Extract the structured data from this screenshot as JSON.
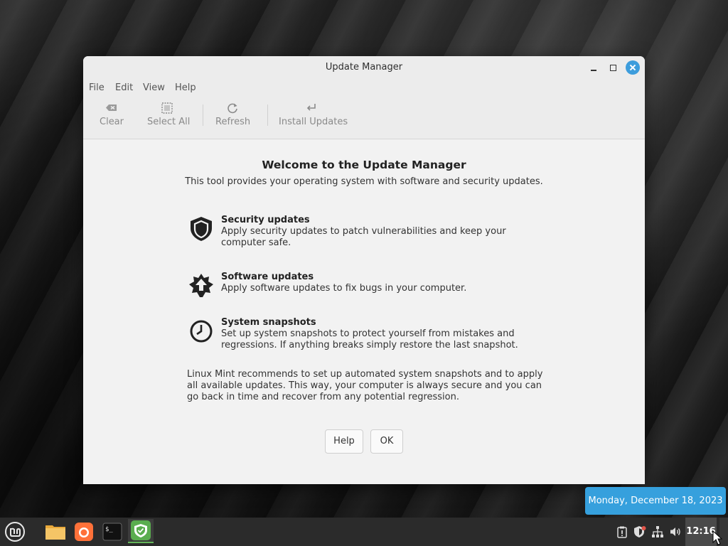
{
  "window": {
    "title": "Update Manager",
    "menu": [
      "File",
      "Edit",
      "View",
      "Help"
    ],
    "toolbar": {
      "clear": "Clear",
      "select_all": "Select All",
      "refresh": "Refresh",
      "install_updates": "Install Updates"
    }
  },
  "welcome": {
    "title": "Welcome to the Update Manager",
    "subtitle": "This tool provides your operating system with software and security updates.",
    "features": [
      {
        "icon": "shield-icon",
        "title": "Security updates",
        "description": "Apply security updates to patch vulnerabilities and keep your computer safe."
      },
      {
        "icon": "star-arrow-icon",
        "title": "Software updates",
        "description": "Apply software updates to fix bugs in your computer."
      },
      {
        "icon": "clock-icon",
        "title": "System snapshots",
        "description": "Set up system snapshots to protect yourself from mistakes and regressions. If anything breaks simply restore the last snapshot."
      }
    ],
    "recommendation": "Linux Mint recommends to set up automated system snapshots and to apply all available updates. This way, your computer is always secure and you can go back in time and recover from any potential regression.",
    "buttons": {
      "help": "Help",
      "ok": "OK"
    }
  },
  "date_popup": "Monday, December 18, 2023",
  "taskbar": {
    "clock": "12:16",
    "launchers": [
      "mint-menu-icon",
      "folder-icon",
      "firefox-icon",
      "terminal-icon",
      "update-manager-icon"
    ],
    "tray": [
      "clipboard-alert-icon",
      "shield-update-icon",
      "network-icon",
      "volume-icon"
    ]
  },
  "colors": {
    "accent": "#36a0dd",
    "close_button": "#3d9ddc",
    "active_indicator": "#64b65a"
  }
}
